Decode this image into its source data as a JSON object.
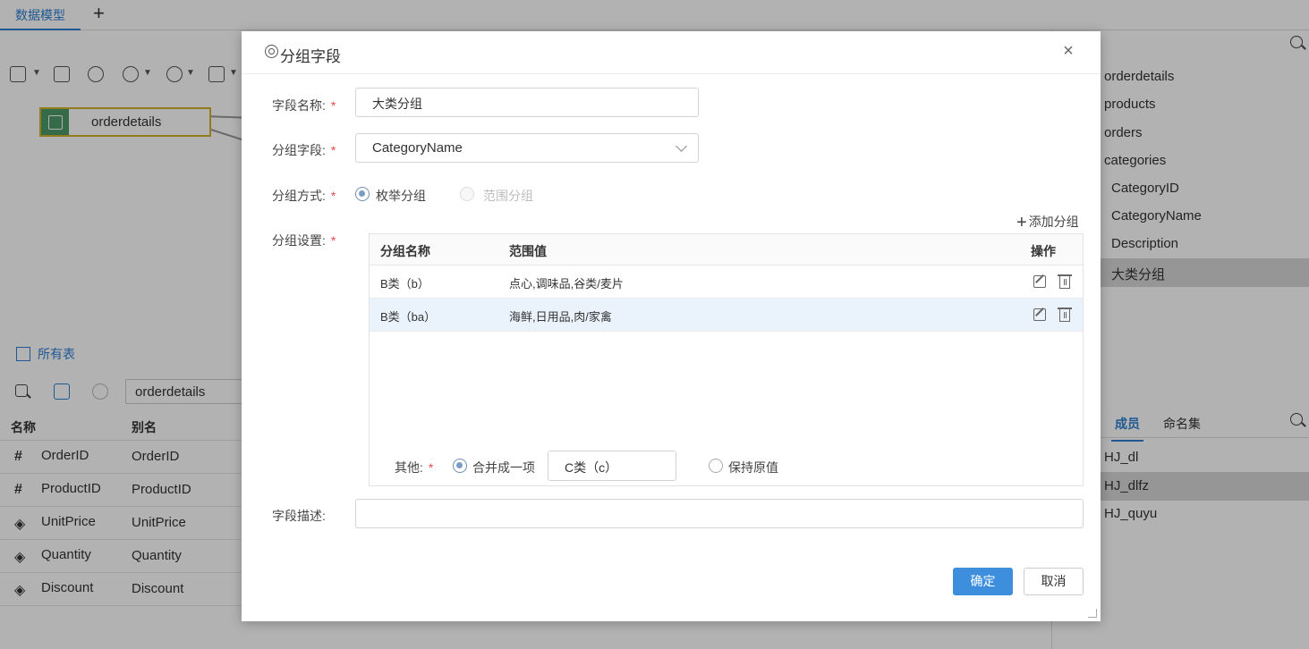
{
  "app": {
    "tab_active": "数据模型",
    "tab_add": "+",
    "canvas_node": "orderdetails",
    "all_tables": "所有表",
    "table_name_value": "orderdetails",
    "grid_headers": {
      "name": "名称",
      "alias": "别名"
    },
    "grid_rows": [
      {
        "icon": "#",
        "name": "OrderID",
        "alias": "OrderID"
      },
      {
        "icon": "#",
        "name": "ProductID",
        "alias": "ProductID"
      },
      {
        "icon": "◈",
        "name": "UnitPrice",
        "alias": "UnitPrice"
      },
      {
        "icon": "◈",
        "name": "Quantity",
        "alias": "Quantity"
      },
      {
        "icon": "◈",
        "name": "Discount",
        "alias": "Discount"
      }
    ]
  },
  "right_panel": {
    "tree": [
      "orderdetails",
      "products",
      "orders",
      "categories",
      "CategoryID",
      "CategoryName",
      "Description",
      "大类分组"
    ],
    "tabs": {
      "members": "成员",
      "named_sets": "命名集"
    },
    "members": [
      "HJ_dl",
      "HJ_dlfz",
      "HJ_quyu"
    ]
  },
  "dialog": {
    "title": "分组字段",
    "close": "×",
    "field_name_label": "字段名称:",
    "field_name_value": "大类分组",
    "group_field_label": "分组字段:",
    "group_field_value": "CategoryName",
    "group_mode_label": "分组方式:",
    "mode_enum": "枚举分组",
    "mode_range": "范围分组",
    "group_settings_label": "分组设置:",
    "add_group": "添加分组",
    "table_headers": {
      "name": "分组名称",
      "range": "范围值",
      "ops": "操作"
    },
    "table_rows": [
      {
        "name": "B类（b）",
        "range": "点心,调味品,谷类/麦片"
      },
      {
        "name": "B类（ba）",
        "range": "海鲜,日用品,肉/家禽"
      }
    ],
    "other_label": "其他:",
    "other_merge": "合并成一项",
    "other_merge_value": "C类（c）",
    "other_keep": "保持原值",
    "desc_label": "字段描述:",
    "ok": "确定",
    "cancel": "取消"
  }
}
